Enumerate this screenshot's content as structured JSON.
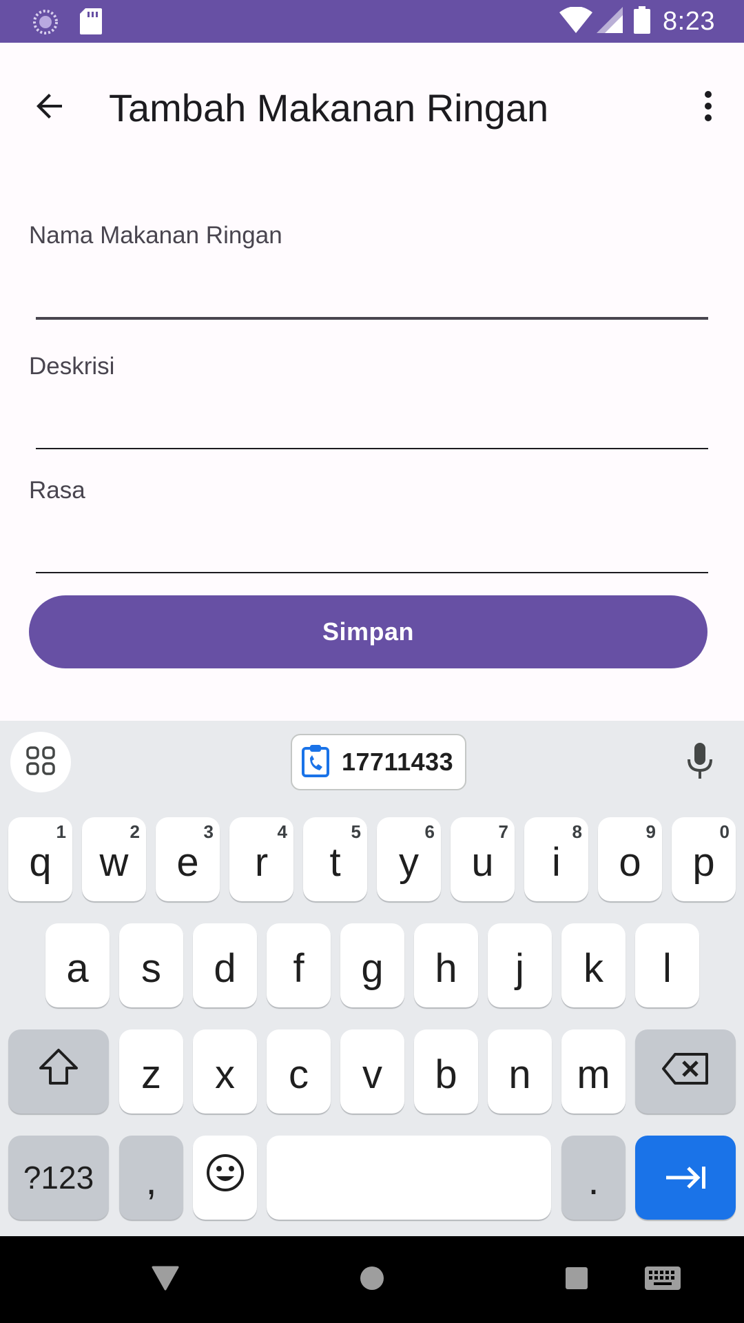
{
  "status_bar": {
    "time": "8:23",
    "icons": [
      "loading-icon",
      "sd-card-icon",
      "wifi-icon",
      "signal-icon",
      "battery-icon"
    ],
    "background": "#6750a4"
  },
  "app_bar": {
    "title": "Tambah Makanan Ringan",
    "back_icon": "arrow-back-icon",
    "more_icon": "more-vert-icon"
  },
  "form": {
    "fields": [
      {
        "label": "Nama Makanan Ringan",
        "value": ""
      },
      {
        "label": "Deskrisi",
        "value": ""
      },
      {
        "label": "Rasa",
        "value": ""
      }
    ],
    "save_label": "Simpan",
    "accent": "#6750a4"
  },
  "keyboard": {
    "clipboard_text": "17711433",
    "row1": [
      {
        "ch": "q",
        "num": "1"
      },
      {
        "ch": "w",
        "num": "2"
      },
      {
        "ch": "e",
        "num": "3"
      },
      {
        "ch": "r",
        "num": "4"
      },
      {
        "ch": "t",
        "num": "5"
      },
      {
        "ch": "y",
        "num": "6"
      },
      {
        "ch": "u",
        "num": "7"
      },
      {
        "ch": "i",
        "num": "8"
      },
      {
        "ch": "o",
        "num": "9"
      },
      {
        "ch": "p",
        "num": "0"
      }
    ],
    "row2": [
      "a",
      "s",
      "d",
      "f",
      "g",
      "h",
      "j",
      "k",
      "l"
    ],
    "row3": [
      "z",
      "x",
      "c",
      "v",
      "b",
      "n",
      "m"
    ],
    "symbols_label": "?123",
    "comma_label": ",",
    "period_label": ".",
    "enter_color": "#1a73e8"
  },
  "nav_bar": {
    "icons": [
      "back-triangle-icon",
      "home-circle-icon",
      "recents-square-icon",
      "keyboard-switch-icon"
    ]
  }
}
